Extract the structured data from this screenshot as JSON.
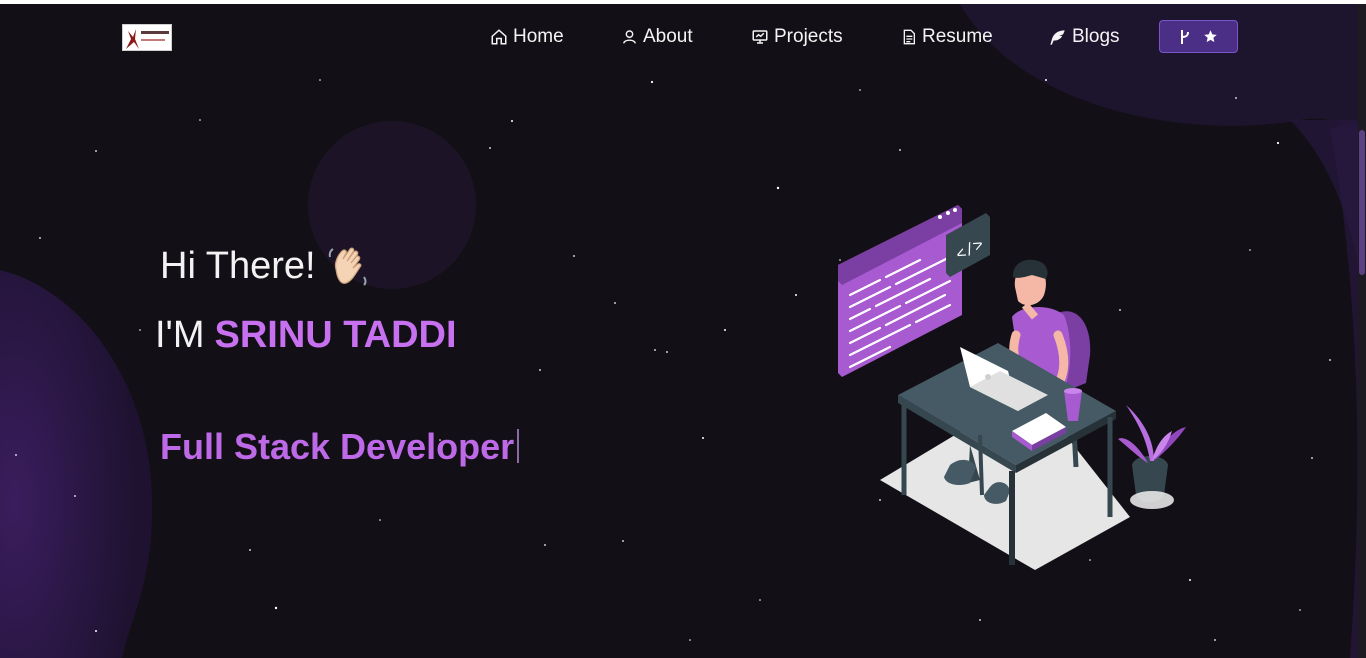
{
  "navbar": {
    "logo_alt": "logo",
    "items": [
      {
        "label": "Home",
        "icon": "home-icon"
      },
      {
        "label": "About",
        "icon": "user-icon"
      },
      {
        "label": "Projects",
        "icon": "projects-icon"
      },
      {
        "label": "Resume",
        "icon": "document-icon"
      },
      {
        "label": "Blogs",
        "icon": "feather-icon"
      }
    ],
    "fork_button": {
      "icons": [
        "git-fork-icon",
        "star-icon"
      ]
    }
  },
  "hero": {
    "greeting": "Hi There!",
    "greeting_emoji": "waving-hand",
    "intro_prefix": "I'M",
    "name": "SRINU TADDI",
    "role": "Full Stack Developer"
  },
  "colors": {
    "background": "#121016",
    "accent": "#c770f0",
    "button_bg": "#4b2f86"
  }
}
